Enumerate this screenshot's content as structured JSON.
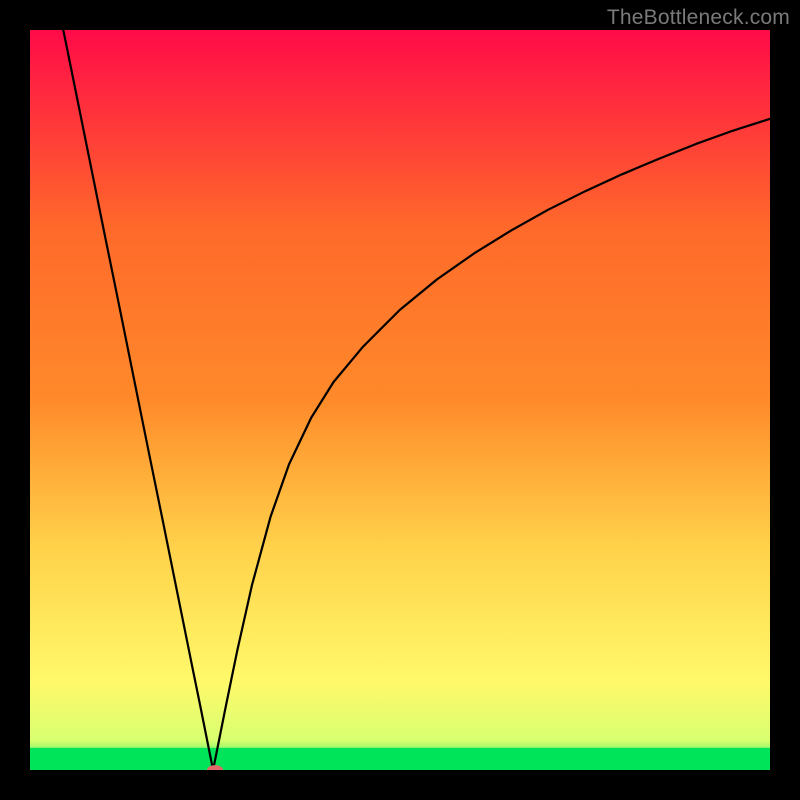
{
  "watermark": "TheBottleneck.com",
  "chart_data": {
    "type": "line",
    "title": "",
    "xlabel": "",
    "ylabel": "",
    "xlim": [
      0,
      100
    ],
    "ylim": [
      0,
      100
    ],
    "grid": false,
    "legend": false,
    "background_gradient": {
      "top": "#ff0b48",
      "mid_upper": "#ff8a2a",
      "mid": "#ffd24a",
      "mid_lower": "#fff96a",
      "bottom": "#00e45a"
    },
    "green_band_fraction": 0.03,
    "minimum_marker": {
      "x": 25,
      "y": 0,
      "color": "#e06a6a",
      "radius": 1.2
    },
    "series": [
      {
        "name": "curve",
        "x": [
          4.5,
          6,
          8,
          10,
          12,
          14,
          16,
          18,
          20,
          22,
          23,
          24,
          24.74,
          25.5,
          26.5,
          28,
          30,
          32.5,
          35,
          38,
          41,
          45,
          50,
          55,
          60,
          65,
          70,
          75,
          80,
          85,
          90,
          95,
          100
        ],
        "y": [
          100,
          92.6,
          82.7,
          72.8,
          63.0,
          53.1,
          43.2,
          33.4,
          23.5,
          13.6,
          8.7,
          3.7,
          0.0,
          3.8,
          8.8,
          16.1,
          25.0,
          34.2,
          41.3,
          47.6,
          52.4,
          57.2,
          62.2,
          66.3,
          69.8,
          72.9,
          75.7,
          78.2,
          80.5,
          82.6,
          84.6,
          86.4,
          88.0
        ]
      }
    ]
  }
}
